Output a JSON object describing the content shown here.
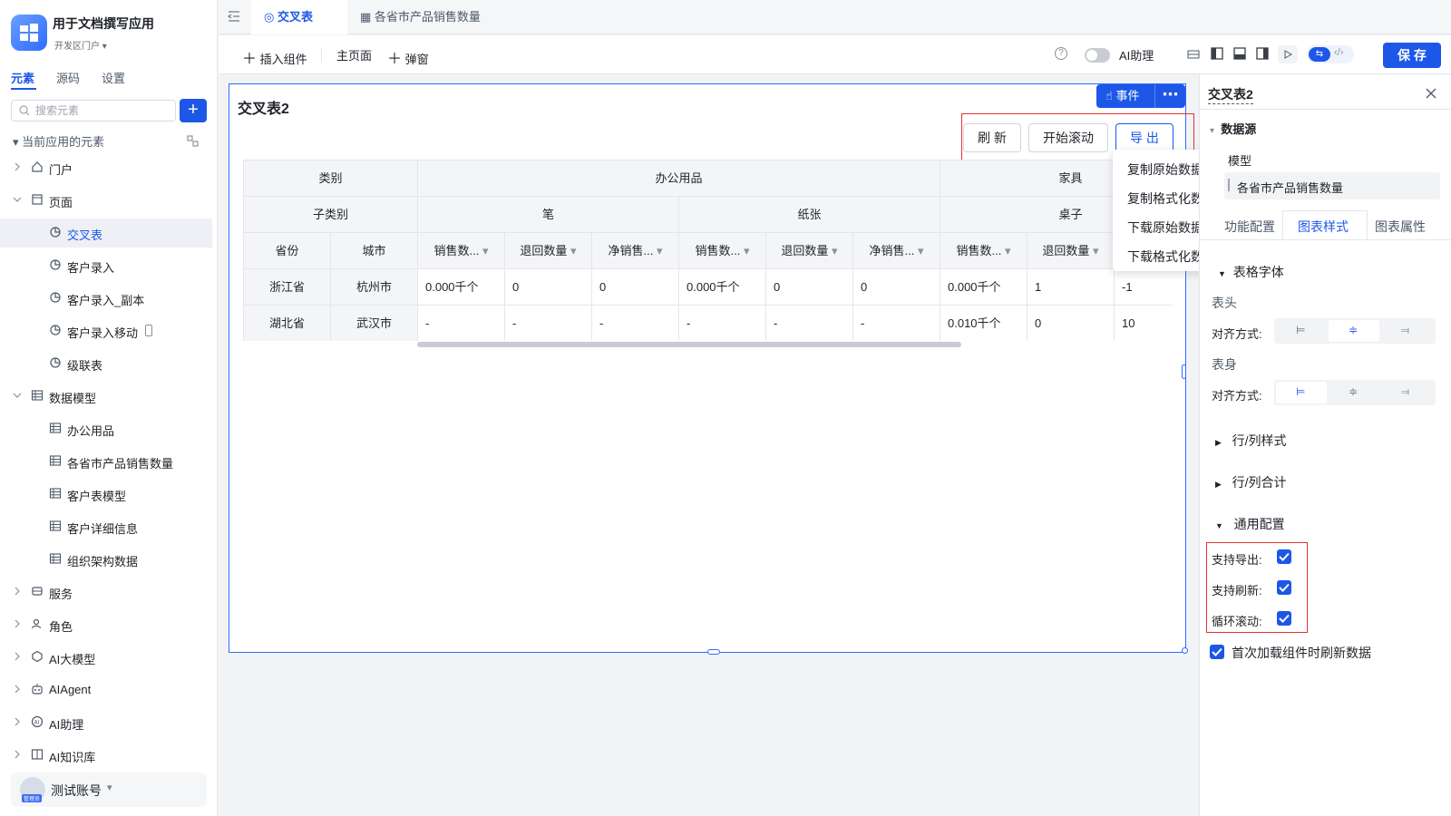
{
  "app": {
    "name": "用于文档撰写应用",
    "portal": "开发区门户"
  },
  "sidebar": {
    "tabs": [
      "元素",
      "源码",
      "设置"
    ],
    "active_tab": "元素",
    "search_placeholder": "搜索元素",
    "section_title": "当前应用的元素",
    "items": [
      {
        "label": "门户",
        "icon": "home-icon",
        "level": 0
      },
      {
        "label": "页面",
        "icon": "page-icon",
        "level": 0
      },
      {
        "label": "交叉表",
        "icon": "chart-icon",
        "level": 1,
        "selected": true
      },
      {
        "label": "客户录入",
        "icon": "chart-icon",
        "level": 1
      },
      {
        "label": "客户录入_副本",
        "icon": "chart-icon",
        "level": 1
      },
      {
        "label": "客户录入移动",
        "icon": "chart-icon",
        "level": 1
      },
      {
        "label": "级联表",
        "icon": "chart-icon",
        "level": 1
      },
      {
        "label": "数据模型",
        "icon": "table-icon",
        "level": 0
      },
      {
        "label": "办公用品",
        "icon": "table-icon",
        "level": 1
      },
      {
        "label": "各省市产品销售数量",
        "icon": "table-icon",
        "level": 1
      },
      {
        "label": "客户表模型",
        "icon": "table-icon",
        "level": 1
      },
      {
        "label": "客户详细信息",
        "icon": "table-icon",
        "level": 1
      },
      {
        "label": "组织架构数据",
        "icon": "table-icon",
        "level": 1
      },
      {
        "label": "服务",
        "icon": "service-icon",
        "level": 0
      },
      {
        "label": "角色",
        "icon": "role-icon",
        "level": 0
      },
      {
        "label": "AI大模型",
        "icon": "ai-model-icon",
        "level": 0
      },
      {
        "label": "AIAgent",
        "icon": "robot-icon",
        "level": 0
      },
      {
        "label": "AI助理",
        "icon": "ai-assistant-icon",
        "level": 0
      },
      {
        "label": "AI知识库",
        "icon": "book-icon",
        "level": 0
      }
    ],
    "account": {
      "name": "测试账号",
      "role": "管理员"
    }
  },
  "doc_tabs": [
    {
      "label": "交叉表",
      "active": true
    },
    {
      "label": "各省市产品销售数量",
      "active": false
    }
  ],
  "toolbar": {
    "insert_label": "插入组件",
    "home_label": "主页面",
    "popup_label": "弹窗",
    "ai_label": "AI助理",
    "save_label": "保 存"
  },
  "widget": {
    "title": "交叉表2",
    "event_label": "事件",
    "buttons": [
      "刷 新",
      "开始滚动",
      "导 出"
    ],
    "export_menu": [
      "复制原始数据",
      "复制格式化数据",
      "下载原始数据",
      "下载格式化数据"
    ],
    "table": {
      "hdr_row1": {
        "corner": "类别",
        "groups": [
          "办公用品",
          "家具"
        ]
      },
      "hdr_row2": {
        "corner": "子类别",
        "groups": [
          "笔",
          "纸张",
          "桌子"
        ]
      },
      "hdr_row3": [
        "省份",
        "城市",
        "销售数...",
        "退回数量",
        "净销售...",
        "销售数...",
        "退回数量",
        "净销售...",
        "销售数...",
        "退回数量",
        ""
      ],
      "rows": [
        [
          "浙江省",
          "杭州市",
          "0.000千个",
          "0",
          "0",
          "0.000千个",
          "0",
          "0",
          "0.000千个",
          "1",
          "-1"
        ],
        [
          "湖北省",
          "武汉市",
          "-",
          "-",
          "-",
          "-",
          "-",
          "-",
          "0.010千个",
          "0",
          "10"
        ]
      ]
    }
  },
  "panel": {
    "title": "交叉表2",
    "datasource_label": "数据源",
    "model_label": "模型",
    "model_value": "各省市产品销售数量",
    "tabs": [
      "功能配置",
      "图表样式",
      "图表属性"
    ],
    "active_tab": "图表样式",
    "font_section": "表格字体",
    "header_label": "表头",
    "body_label": "表身",
    "align_label": "对齐方式:",
    "row_col_style": "行/列样式",
    "row_col_total": "行/列合计",
    "general_config": "通用配置",
    "options": [
      {
        "label": "支持导出:",
        "checked": true
      },
      {
        "label": "支持刷新:",
        "checked": true
      },
      {
        "label": "循环滚动:",
        "checked": true
      }
    ],
    "first_load": {
      "label": "首次加载组件时刷新数据",
      "checked": true
    }
  }
}
